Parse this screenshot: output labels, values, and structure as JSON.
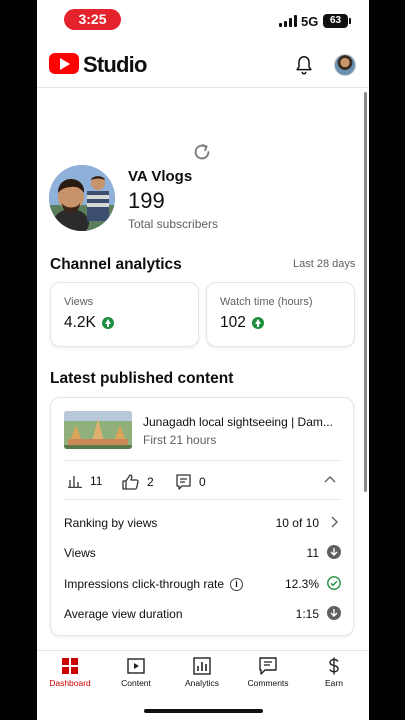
{
  "status": {
    "time": "3:25",
    "network": "5G",
    "battery": "63"
  },
  "header": {
    "brand": "Studio"
  },
  "channel": {
    "name": "VA Vlogs",
    "subscribers": "199",
    "subscribers_label": "Total subscribers"
  },
  "analytics": {
    "title": "Channel analytics",
    "period": "Last 28 days",
    "cards": [
      {
        "label": "Views",
        "value": "4.2K",
        "trend": "up"
      },
      {
        "label": "Watch time (hours)",
        "value": "102",
        "trend": "up"
      }
    ]
  },
  "latest": {
    "title": "Latest published content",
    "video_title": "Junagadh local sightseeing | Dam...",
    "video_age": "First 21 hours",
    "metrics": {
      "views": "11",
      "likes": "2",
      "comments": "0"
    },
    "rows": [
      {
        "label": "Ranking by views",
        "value": "10 of 10",
        "icon": "chevron-right-icon"
      },
      {
        "label": "Views",
        "value": "11",
        "icon": "arrow-down-circle-icon"
      },
      {
        "label": "Impressions click-through rate",
        "value": "12.3%",
        "icon": "check-circle-icon"
      },
      {
        "label": "Average view duration",
        "value": "1:15",
        "icon": "arrow-down-circle-icon"
      }
    ]
  },
  "nav": {
    "items": [
      {
        "label": "Dashboard",
        "icon": "dashboard-icon",
        "active": true
      },
      {
        "label": "Content",
        "icon": "content-icon"
      },
      {
        "label": "Analytics",
        "icon": "analytics-icon"
      },
      {
        "label": "Comments",
        "icon": "comments-icon"
      },
      {
        "label": "Earn",
        "icon": "earn-icon"
      }
    ]
  },
  "colors": {
    "accent": "#ff0000",
    "active_nav": "#cc0000",
    "trend_up": "#1e8e3e",
    "status_pill": "#e5232d"
  }
}
